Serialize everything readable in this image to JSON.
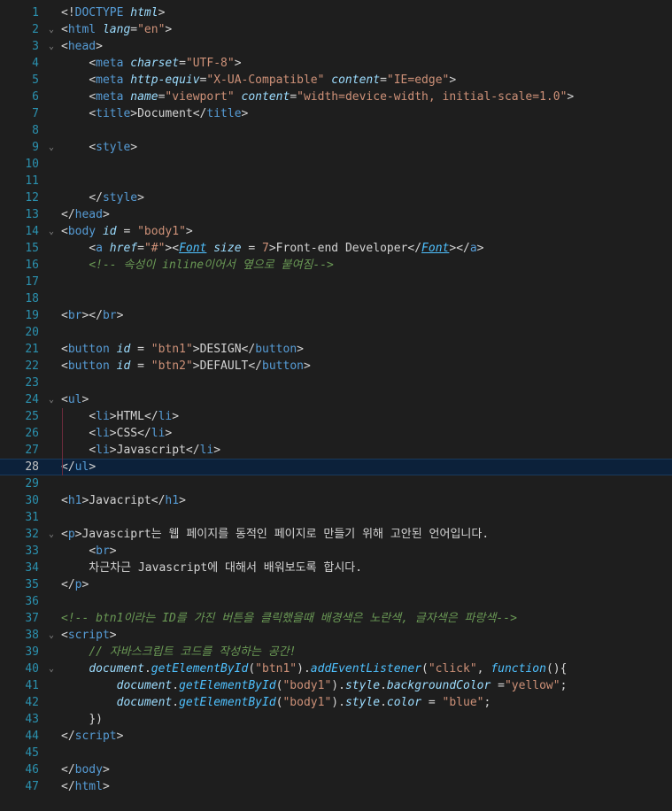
{
  "editor": {
    "language": "html",
    "current_line": 28,
    "colors": {
      "background": "#1e1e1e",
      "line_number": "#2b91af",
      "tag": "#569cd6",
      "attribute": "#9cdcfe",
      "string": "#ce9178",
      "comment": "#6a9955",
      "text": "#d4d4d4",
      "current_line_bg": "#0c213a"
    },
    "lines": [
      {
        "n": "1",
        "fold": "",
        "tokens": [
          [
            "punc",
            "<!"
          ],
          [
            "k",
            "DOCTYPE"
          ],
          [
            "t",
            " "
          ],
          [
            "a",
            "html"
          ],
          [
            "punc",
            ">"
          ]
        ]
      },
      {
        "n": "2",
        "fold": "v",
        "tokens": [
          [
            "punc",
            "<"
          ],
          [
            "k",
            "html"
          ],
          [
            "t",
            " "
          ],
          [
            "a",
            "lang"
          ],
          [
            "punc",
            "="
          ],
          [
            "s",
            "\"en\""
          ],
          [
            "punc",
            ">"
          ]
        ]
      },
      {
        "n": "3",
        "fold": "v",
        "tokens": [
          [
            "punc",
            "<"
          ],
          [
            "k",
            "head"
          ],
          [
            "punc",
            ">"
          ]
        ]
      },
      {
        "n": "4",
        "fold": "",
        "tokens": [
          [
            "t",
            "    "
          ],
          [
            "punc",
            "<"
          ],
          [
            "k",
            "meta"
          ],
          [
            "t",
            " "
          ],
          [
            "a",
            "charset"
          ],
          [
            "punc",
            "="
          ],
          [
            "s",
            "\"UTF-8\""
          ],
          [
            "punc",
            ">"
          ]
        ]
      },
      {
        "n": "5",
        "fold": "",
        "tokens": [
          [
            "t",
            "    "
          ],
          [
            "punc",
            "<"
          ],
          [
            "k",
            "meta"
          ],
          [
            "t",
            " "
          ],
          [
            "a",
            "http-equiv"
          ],
          [
            "punc",
            "="
          ],
          [
            "s",
            "\"X-UA-Compatible\""
          ],
          [
            "t",
            " "
          ],
          [
            "a",
            "content"
          ],
          [
            "punc",
            "="
          ],
          [
            "s",
            "\"IE=edge\""
          ],
          [
            "punc",
            ">"
          ]
        ]
      },
      {
        "n": "6",
        "fold": "",
        "tokens": [
          [
            "t",
            "    "
          ],
          [
            "punc",
            "<"
          ],
          [
            "k",
            "meta"
          ],
          [
            "t",
            " "
          ],
          [
            "a",
            "name"
          ],
          [
            "punc",
            "="
          ],
          [
            "s",
            "\"viewport\""
          ],
          [
            "t",
            " "
          ],
          [
            "a",
            "content"
          ],
          [
            "punc",
            "="
          ],
          [
            "s",
            "\"width=device-width, initial-scale=1.0\""
          ],
          [
            "punc",
            ">"
          ]
        ]
      },
      {
        "n": "7",
        "fold": "",
        "tokens": [
          [
            "t",
            "    "
          ],
          [
            "punc",
            "<"
          ],
          [
            "k",
            "title"
          ],
          [
            "punc",
            ">"
          ],
          [
            "t",
            "Document"
          ],
          [
            "punc",
            "</"
          ],
          [
            "k",
            "title"
          ],
          [
            "punc",
            ">"
          ]
        ]
      },
      {
        "n": "8",
        "fold": "",
        "tokens": []
      },
      {
        "n": "9",
        "fold": "v",
        "tokens": [
          [
            "t",
            "    "
          ],
          [
            "punc",
            "<"
          ],
          [
            "k",
            "style"
          ],
          [
            "punc",
            ">"
          ]
        ]
      },
      {
        "n": "10",
        "fold": "",
        "tokens": []
      },
      {
        "n": "11",
        "fold": "",
        "tokens": []
      },
      {
        "n": "12",
        "fold": "",
        "tokens": [
          [
            "t",
            "    "
          ],
          [
            "punc",
            "</"
          ],
          [
            "k",
            "style"
          ],
          [
            "punc",
            ">"
          ]
        ]
      },
      {
        "n": "13",
        "fold": "",
        "tokens": [
          [
            "punc",
            "</"
          ],
          [
            "k",
            "head"
          ],
          [
            "punc",
            ">"
          ]
        ]
      },
      {
        "n": "14",
        "fold": "v",
        "tokens": [
          [
            "punc",
            "<"
          ],
          [
            "k",
            "body"
          ],
          [
            "t",
            " "
          ],
          [
            "a",
            "id"
          ],
          [
            "t",
            " "
          ],
          [
            "punc",
            "="
          ],
          [
            "t",
            " "
          ],
          [
            "s",
            "\"body1\""
          ],
          [
            "punc",
            ">"
          ]
        ]
      },
      {
        "n": "15",
        "fold": "",
        "tokens": [
          [
            "t",
            "    "
          ],
          [
            "punc",
            "<"
          ],
          [
            "k",
            "a"
          ],
          [
            "t",
            " "
          ],
          [
            "a",
            "href"
          ],
          [
            "punc",
            "="
          ],
          [
            "s",
            "\"#\""
          ],
          [
            "punc",
            ">"
          ],
          [
            "punc",
            "<"
          ],
          [
            "fi",
            "Font"
          ],
          [
            "t",
            " "
          ],
          [
            "a",
            "size"
          ],
          [
            "t",
            " "
          ],
          [
            "punc",
            "="
          ],
          [
            "t",
            " "
          ],
          [
            "s",
            "7"
          ],
          [
            "punc",
            ">"
          ],
          [
            "t",
            "Front-end Developer"
          ],
          [
            "punc",
            "</"
          ],
          [
            "fi",
            "Font"
          ],
          [
            "punc",
            ">"
          ],
          [
            "punc",
            "</"
          ],
          [
            "k",
            "a"
          ],
          [
            "punc",
            ">"
          ]
        ]
      },
      {
        "n": "16",
        "fold": "",
        "tokens": [
          [
            "t",
            "    "
          ],
          [
            "c",
            "<!-- 속성이 inline이어서 옆으로 붙여짐-->"
          ]
        ]
      },
      {
        "n": "17",
        "fold": "",
        "tokens": []
      },
      {
        "n": "18",
        "fold": "",
        "tokens": []
      },
      {
        "n": "19",
        "fold": "",
        "tokens": [
          [
            "punc",
            "<"
          ],
          [
            "k",
            "br"
          ],
          [
            "punc",
            "></"
          ],
          [
            "k",
            "br"
          ],
          [
            "punc",
            ">"
          ]
        ]
      },
      {
        "n": "20",
        "fold": "",
        "tokens": []
      },
      {
        "n": "21",
        "fold": "",
        "tokens": [
          [
            "punc",
            "<"
          ],
          [
            "k",
            "button"
          ],
          [
            "t",
            " "
          ],
          [
            "a",
            "id"
          ],
          [
            "t",
            " "
          ],
          [
            "punc",
            "="
          ],
          [
            "t",
            " "
          ],
          [
            "s",
            "\"btn1\""
          ],
          [
            "punc",
            ">"
          ],
          [
            "t",
            "DESIGN"
          ],
          [
            "punc",
            "</"
          ],
          [
            "k",
            "button"
          ],
          [
            "punc",
            ">"
          ]
        ]
      },
      {
        "n": "22",
        "fold": "",
        "tokens": [
          [
            "punc",
            "<"
          ],
          [
            "k",
            "button"
          ],
          [
            "t",
            " "
          ],
          [
            "a",
            "id"
          ],
          [
            "t",
            " "
          ],
          [
            "punc",
            "="
          ],
          [
            "t",
            " "
          ],
          [
            "s",
            "\"btn2\""
          ],
          [
            "punc",
            ">"
          ],
          [
            "t",
            "DEFAULT"
          ],
          [
            "punc",
            "</"
          ],
          [
            "k",
            "button"
          ],
          [
            "punc",
            ">"
          ]
        ]
      },
      {
        "n": "23",
        "fold": "",
        "tokens": []
      },
      {
        "n": "24",
        "fold": "v",
        "tokens": [
          [
            "punc",
            "<"
          ],
          [
            "k",
            "ul"
          ],
          [
            "punc",
            ">"
          ]
        ]
      },
      {
        "n": "25",
        "fold": "",
        "tokens": [
          [
            "t",
            "    "
          ],
          [
            "punc",
            "<"
          ],
          [
            "k",
            "li"
          ],
          [
            "punc",
            ">"
          ],
          [
            "t",
            "HTML"
          ],
          [
            "punc",
            "</"
          ],
          [
            "k",
            "li"
          ],
          [
            "punc",
            ">"
          ]
        ]
      },
      {
        "n": "26",
        "fold": "",
        "tokens": [
          [
            "t",
            "    "
          ],
          [
            "punc",
            "<"
          ],
          [
            "k",
            "li"
          ],
          [
            "punc",
            ">"
          ],
          [
            "t",
            "CSS"
          ],
          [
            "punc",
            "</"
          ],
          [
            "k",
            "li"
          ],
          [
            "punc",
            ">"
          ]
        ]
      },
      {
        "n": "27",
        "fold": "",
        "tokens": [
          [
            "t",
            "    "
          ],
          [
            "punc",
            "<"
          ],
          [
            "k",
            "li"
          ],
          [
            "punc",
            ">"
          ],
          [
            "t",
            "Javascript"
          ],
          [
            "punc",
            "</"
          ],
          [
            "k",
            "li"
          ],
          [
            "punc",
            ">"
          ]
        ]
      },
      {
        "n": "28",
        "fold": "",
        "tokens": [
          [
            "punc",
            "</"
          ],
          [
            "k",
            "ul"
          ],
          [
            "punc",
            ">"
          ]
        ]
      },
      {
        "n": "29",
        "fold": "",
        "tokens": []
      },
      {
        "n": "30",
        "fold": "",
        "tokens": [
          [
            "punc",
            "<"
          ],
          [
            "k",
            "h1"
          ],
          [
            "punc",
            ">"
          ],
          [
            "t",
            "Javacript"
          ],
          [
            "punc",
            "</"
          ],
          [
            "k",
            "h1"
          ],
          [
            "punc",
            ">"
          ]
        ]
      },
      {
        "n": "31",
        "fold": "",
        "tokens": []
      },
      {
        "n": "32",
        "fold": "v",
        "tokens": [
          [
            "punc",
            "<"
          ],
          [
            "k",
            "p"
          ],
          [
            "punc",
            ">"
          ],
          [
            "t",
            "Javasciprt는 웹 페이지를 동적인 페이지로 만들기 위해 고안된 언어입니다."
          ]
        ]
      },
      {
        "n": "33",
        "fold": "",
        "tokens": [
          [
            "t",
            "    "
          ],
          [
            "punc",
            "<"
          ],
          [
            "k",
            "br"
          ],
          [
            "punc",
            ">"
          ]
        ]
      },
      {
        "n": "34",
        "fold": "",
        "tokens": [
          [
            "t",
            "    차근차근 Javascript에 대해서 배워보도록 합시다."
          ]
        ]
      },
      {
        "n": "35",
        "fold": "",
        "tokens": [
          [
            "punc",
            "</"
          ],
          [
            "k",
            "p"
          ],
          [
            "punc",
            ">"
          ]
        ]
      },
      {
        "n": "36",
        "fold": "",
        "tokens": []
      },
      {
        "n": "37",
        "fold": "",
        "tokens": [
          [
            "c",
            "<!-- btn1이라는 ID를 가진 버튼을 클릭했을때 배경색은 노란색, 글자색은 파랑색-->"
          ]
        ]
      },
      {
        "n": "38",
        "fold": "v",
        "tokens": [
          [
            "punc",
            "<"
          ],
          [
            "k",
            "script"
          ],
          [
            "punc",
            ">"
          ]
        ]
      },
      {
        "n": "39",
        "fold": "",
        "tokens": [
          [
            "t",
            "    "
          ],
          [
            "c",
            "// 자바스크립트 코드를 작성하는 공간!"
          ]
        ]
      },
      {
        "n": "40",
        "fold": "v",
        "tokens": [
          [
            "t",
            "    "
          ],
          [
            "p",
            "document"
          ],
          [
            "punc",
            "."
          ],
          [
            "fi",
            "getElementById"
          ],
          [
            "punc",
            "("
          ],
          [
            "s",
            "\"btn1\""
          ],
          [
            "punc",
            ")."
          ],
          [
            "fi",
            "addEventListener"
          ],
          [
            "punc",
            "("
          ],
          [
            "s",
            "\"click\""
          ],
          [
            "punc",
            ", "
          ],
          [
            "fi",
            "function"
          ],
          [
            "punc",
            "(){"
          ]
        ]
      },
      {
        "n": "41",
        "fold": "",
        "tokens": [
          [
            "t",
            "        "
          ],
          [
            "p",
            "document"
          ],
          [
            "punc",
            "."
          ],
          [
            "fi",
            "getElementById"
          ],
          [
            "punc",
            "("
          ],
          [
            "s",
            "\"body1\""
          ],
          [
            "punc",
            ")."
          ],
          [
            "p",
            "style"
          ],
          [
            "punc",
            "."
          ],
          [
            "p",
            "backgroundColor"
          ],
          [
            "t",
            " "
          ],
          [
            "punc",
            "="
          ],
          [
            "s",
            "\"yellow\""
          ],
          [
            "punc",
            ";"
          ]
        ]
      },
      {
        "n": "42",
        "fold": "",
        "tokens": [
          [
            "t",
            "        "
          ],
          [
            "p",
            "document"
          ],
          [
            "punc",
            "."
          ],
          [
            "fi",
            "getElementById"
          ],
          [
            "punc",
            "("
          ],
          [
            "s",
            "\"body1\""
          ],
          [
            "punc",
            ")."
          ],
          [
            "p",
            "style"
          ],
          [
            "punc",
            "."
          ],
          [
            "p",
            "color"
          ],
          [
            "t",
            " "
          ],
          [
            "punc",
            "="
          ],
          [
            "t",
            " "
          ],
          [
            "s",
            "\"blue\""
          ],
          [
            "punc",
            ";"
          ]
        ]
      },
      {
        "n": "43",
        "fold": "",
        "tokens": [
          [
            "t",
            "    "
          ],
          [
            "punc",
            "})"
          ]
        ]
      },
      {
        "n": "44",
        "fold": "",
        "tokens": [
          [
            "punc",
            "</"
          ],
          [
            "k",
            "script"
          ],
          [
            "punc",
            ">"
          ]
        ]
      },
      {
        "n": "45",
        "fold": "",
        "tokens": []
      },
      {
        "n": "46",
        "fold": "",
        "tokens": [
          [
            "punc",
            "</"
          ],
          [
            "k",
            "body"
          ],
          [
            "punc",
            ">"
          ]
        ]
      },
      {
        "n": "47",
        "fold": "",
        "tokens": [
          [
            "punc",
            "</"
          ],
          [
            "k",
            "html"
          ],
          [
            "punc",
            ">"
          ]
        ]
      }
    ]
  }
}
